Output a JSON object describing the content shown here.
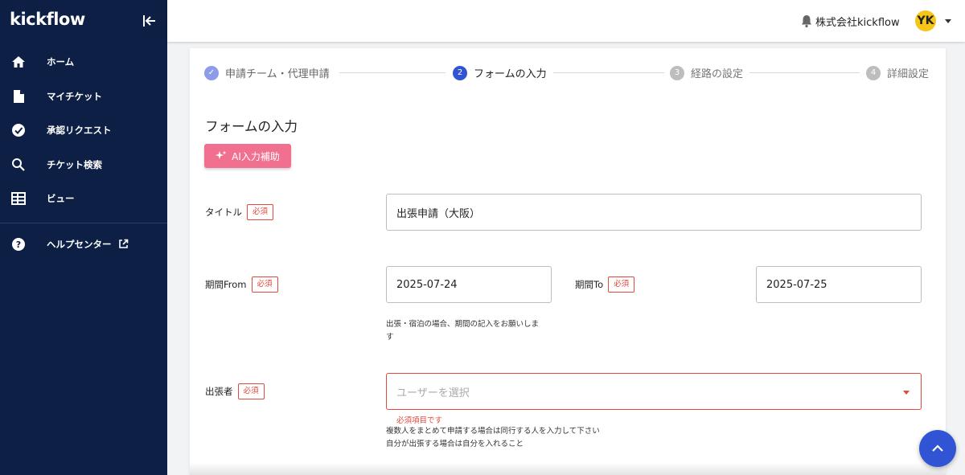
{
  "sidebar": {
    "logo": "kickflow",
    "items": [
      {
        "label": "ホーム",
        "icon": "home-icon"
      },
      {
        "label": "マイチケット",
        "icon": "document-icon"
      },
      {
        "label": "承認リクエスト",
        "icon": "check-circle-icon"
      },
      {
        "label": "チケット検索",
        "icon": "search-icon"
      },
      {
        "label": "ビュー",
        "icon": "grid-icon"
      }
    ],
    "help": {
      "label": "ヘルプセンター",
      "icon": "help-circle-icon"
    }
  },
  "topbar": {
    "company": "株式会社kickflow",
    "avatar": "YK"
  },
  "stepper": {
    "steps": [
      {
        "num": "✓",
        "label": "申請チーム・代理申請",
        "state": "done"
      },
      {
        "num": "2",
        "label": "フォームの入力",
        "state": "active"
      },
      {
        "num": "3",
        "label": "経路の設定",
        "state": "todo"
      },
      {
        "num": "4",
        "label": "詳細設定",
        "state": "todo"
      }
    ]
  },
  "form": {
    "section_title": "フォームの入力",
    "ai_button": "AI入力補助",
    "required_label": "必須",
    "title_label": "タイトル",
    "title_value": "出張申請（大阪）",
    "from_label": "期間From",
    "from_value": "2025-07-24",
    "to_label": "期間To",
    "to_value": "2025-07-25",
    "period_help_1": "出張・宿泊の場合、期間の記入をお願いしま",
    "period_help_2": "す",
    "traveler_label": "出張者",
    "traveler_placeholder": "ユーザーを選択",
    "traveler_error": "必須項目です",
    "traveler_help_1": "複数人をまとめて申請する場合は同行する人を入力して下さい",
    "traveler_help_2": "自分が出張する場合は自分を入れること"
  },
  "colors": {
    "sidebar_bg": "#0d1f45",
    "accent": "#3154d4",
    "ai_button": "#f2708f",
    "error": "#e0493c",
    "avatar": "#f5c518"
  }
}
